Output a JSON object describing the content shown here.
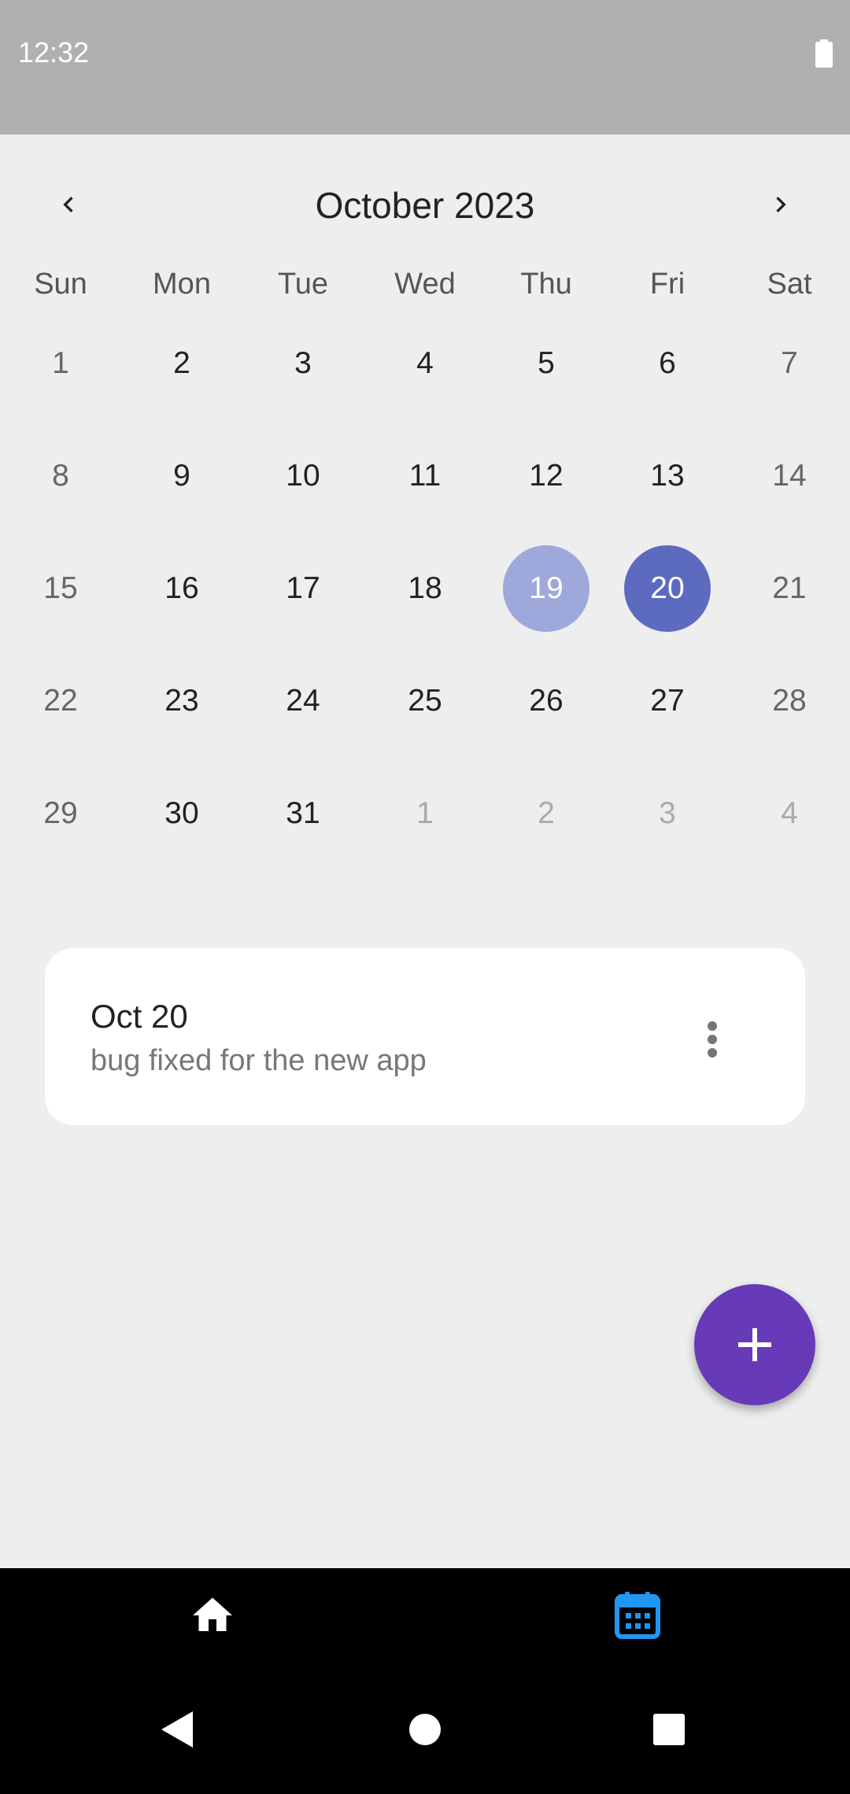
{
  "status_bar": {
    "time": "12:32"
  },
  "calendar": {
    "title": "October 2023",
    "weekdays": [
      "Sun",
      "Mon",
      "Tue",
      "Wed",
      "Thu",
      "Fri",
      "Sat"
    ],
    "weeks": [
      [
        {
          "d": "1",
          "t": "weekend"
        },
        {
          "d": "2",
          "t": "normal"
        },
        {
          "d": "3",
          "t": "normal"
        },
        {
          "d": "4",
          "t": "normal"
        },
        {
          "d": "5",
          "t": "normal"
        },
        {
          "d": "6",
          "t": "normal"
        },
        {
          "d": "7",
          "t": "weekend"
        }
      ],
      [
        {
          "d": "8",
          "t": "weekend"
        },
        {
          "d": "9",
          "t": "normal"
        },
        {
          "d": "10",
          "t": "normal"
        },
        {
          "d": "11",
          "t": "normal"
        },
        {
          "d": "12",
          "t": "normal"
        },
        {
          "d": "13",
          "t": "normal"
        },
        {
          "d": "14",
          "t": "weekend"
        }
      ],
      [
        {
          "d": "15",
          "t": "weekend"
        },
        {
          "d": "16",
          "t": "normal"
        },
        {
          "d": "17",
          "t": "normal"
        },
        {
          "d": "18",
          "t": "normal"
        },
        {
          "d": "19",
          "t": "sel-range"
        },
        {
          "d": "20",
          "t": "sel-today"
        },
        {
          "d": "21",
          "t": "weekend"
        }
      ],
      [
        {
          "d": "22",
          "t": "weekend"
        },
        {
          "d": "23",
          "t": "normal"
        },
        {
          "d": "24",
          "t": "normal"
        },
        {
          "d": "25",
          "t": "normal"
        },
        {
          "d": "26",
          "t": "normal"
        },
        {
          "d": "27",
          "t": "normal"
        },
        {
          "d": "28",
          "t": "weekend"
        }
      ],
      [
        {
          "d": "29",
          "t": "weekend"
        },
        {
          "d": "30",
          "t": "normal"
        },
        {
          "d": "31",
          "t": "normal"
        },
        {
          "d": "1",
          "t": "other"
        },
        {
          "d": "2",
          "t": "other"
        },
        {
          "d": "3",
          "t": "other"
        },
        {
          "d": "4",
          "t": "other"
        }
      ]
    ],
    "selected_date": "20",
    "highlighted_date": "19"
  },
  "event": {
    "title": "Oct 20",
    "description": "bug fixed for the new app",
    "menu_icon": "more-vert-icon"
  },
  "fab": {
    "icon": "plus-icon"
  },
  "bottom_nav": {
    "items": [
      {
        "icon": "home-icon",
        "active": false
      },
      {
        "icon": "calendar-icon",
        "active": true
      }
    ]
  },
  "system_nav": {
    "icons": [
      "back-icon",
      "home-circle-icon",
      "recents-icon"
    ]
  },
  "colors": {
    "accent": "#673ab7",
    "selected_day": "#5c6bc0",
    "range_day": "#9fa8da",
    "active_nav": "#2196f3",
    "status_bar": "#b0b0b0",
    "background": "#eeeeee"
  }
}
